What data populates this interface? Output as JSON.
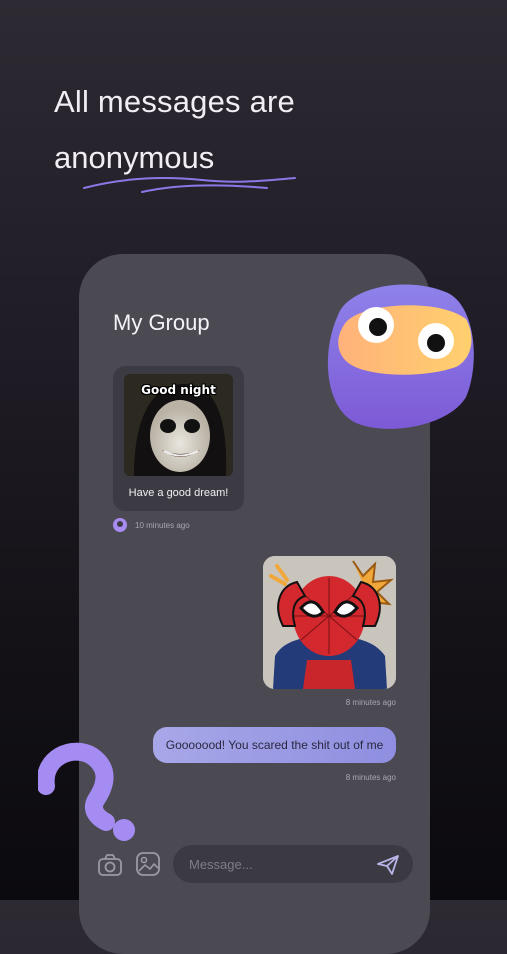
{
  "headline": {
    "line1": "All messages are",
    "line2": "anonymous"
  },
  "chat": {
    "group_title": "My Group",
    "messages": [
      {
        "type": "image_with_caption",
        "image_text": "Good night",
        "caption": "Have a good dream!",
        "time": "10 minutes ago",
        "side": "left"
      },
      {
        "type": "sticker",
        "time": "8 minutes ago",
        "side": "right"
      },
      {
        "type": "text",
        "text": "Gooooood! You scared the shit out of me",
        "time": "8 minutes ago",
        "side": "right"
      }
    ],
    "composer": {
      "placeholder": "Message..."
    }
  },
  "icons": [
    "camera-icon",
    "gallery-icon",
    "send-icon",
    "user-avatar-icon",
    "mascot-blob",
    "question-mark-decoration"
  ],
  "colors": {
    "accent": "#a78bf0",
    "bubble": "#9a9ae5",
    "phone_bg": "#4b4a53",
    "card_bg": "#3c3b44"
  }
}
